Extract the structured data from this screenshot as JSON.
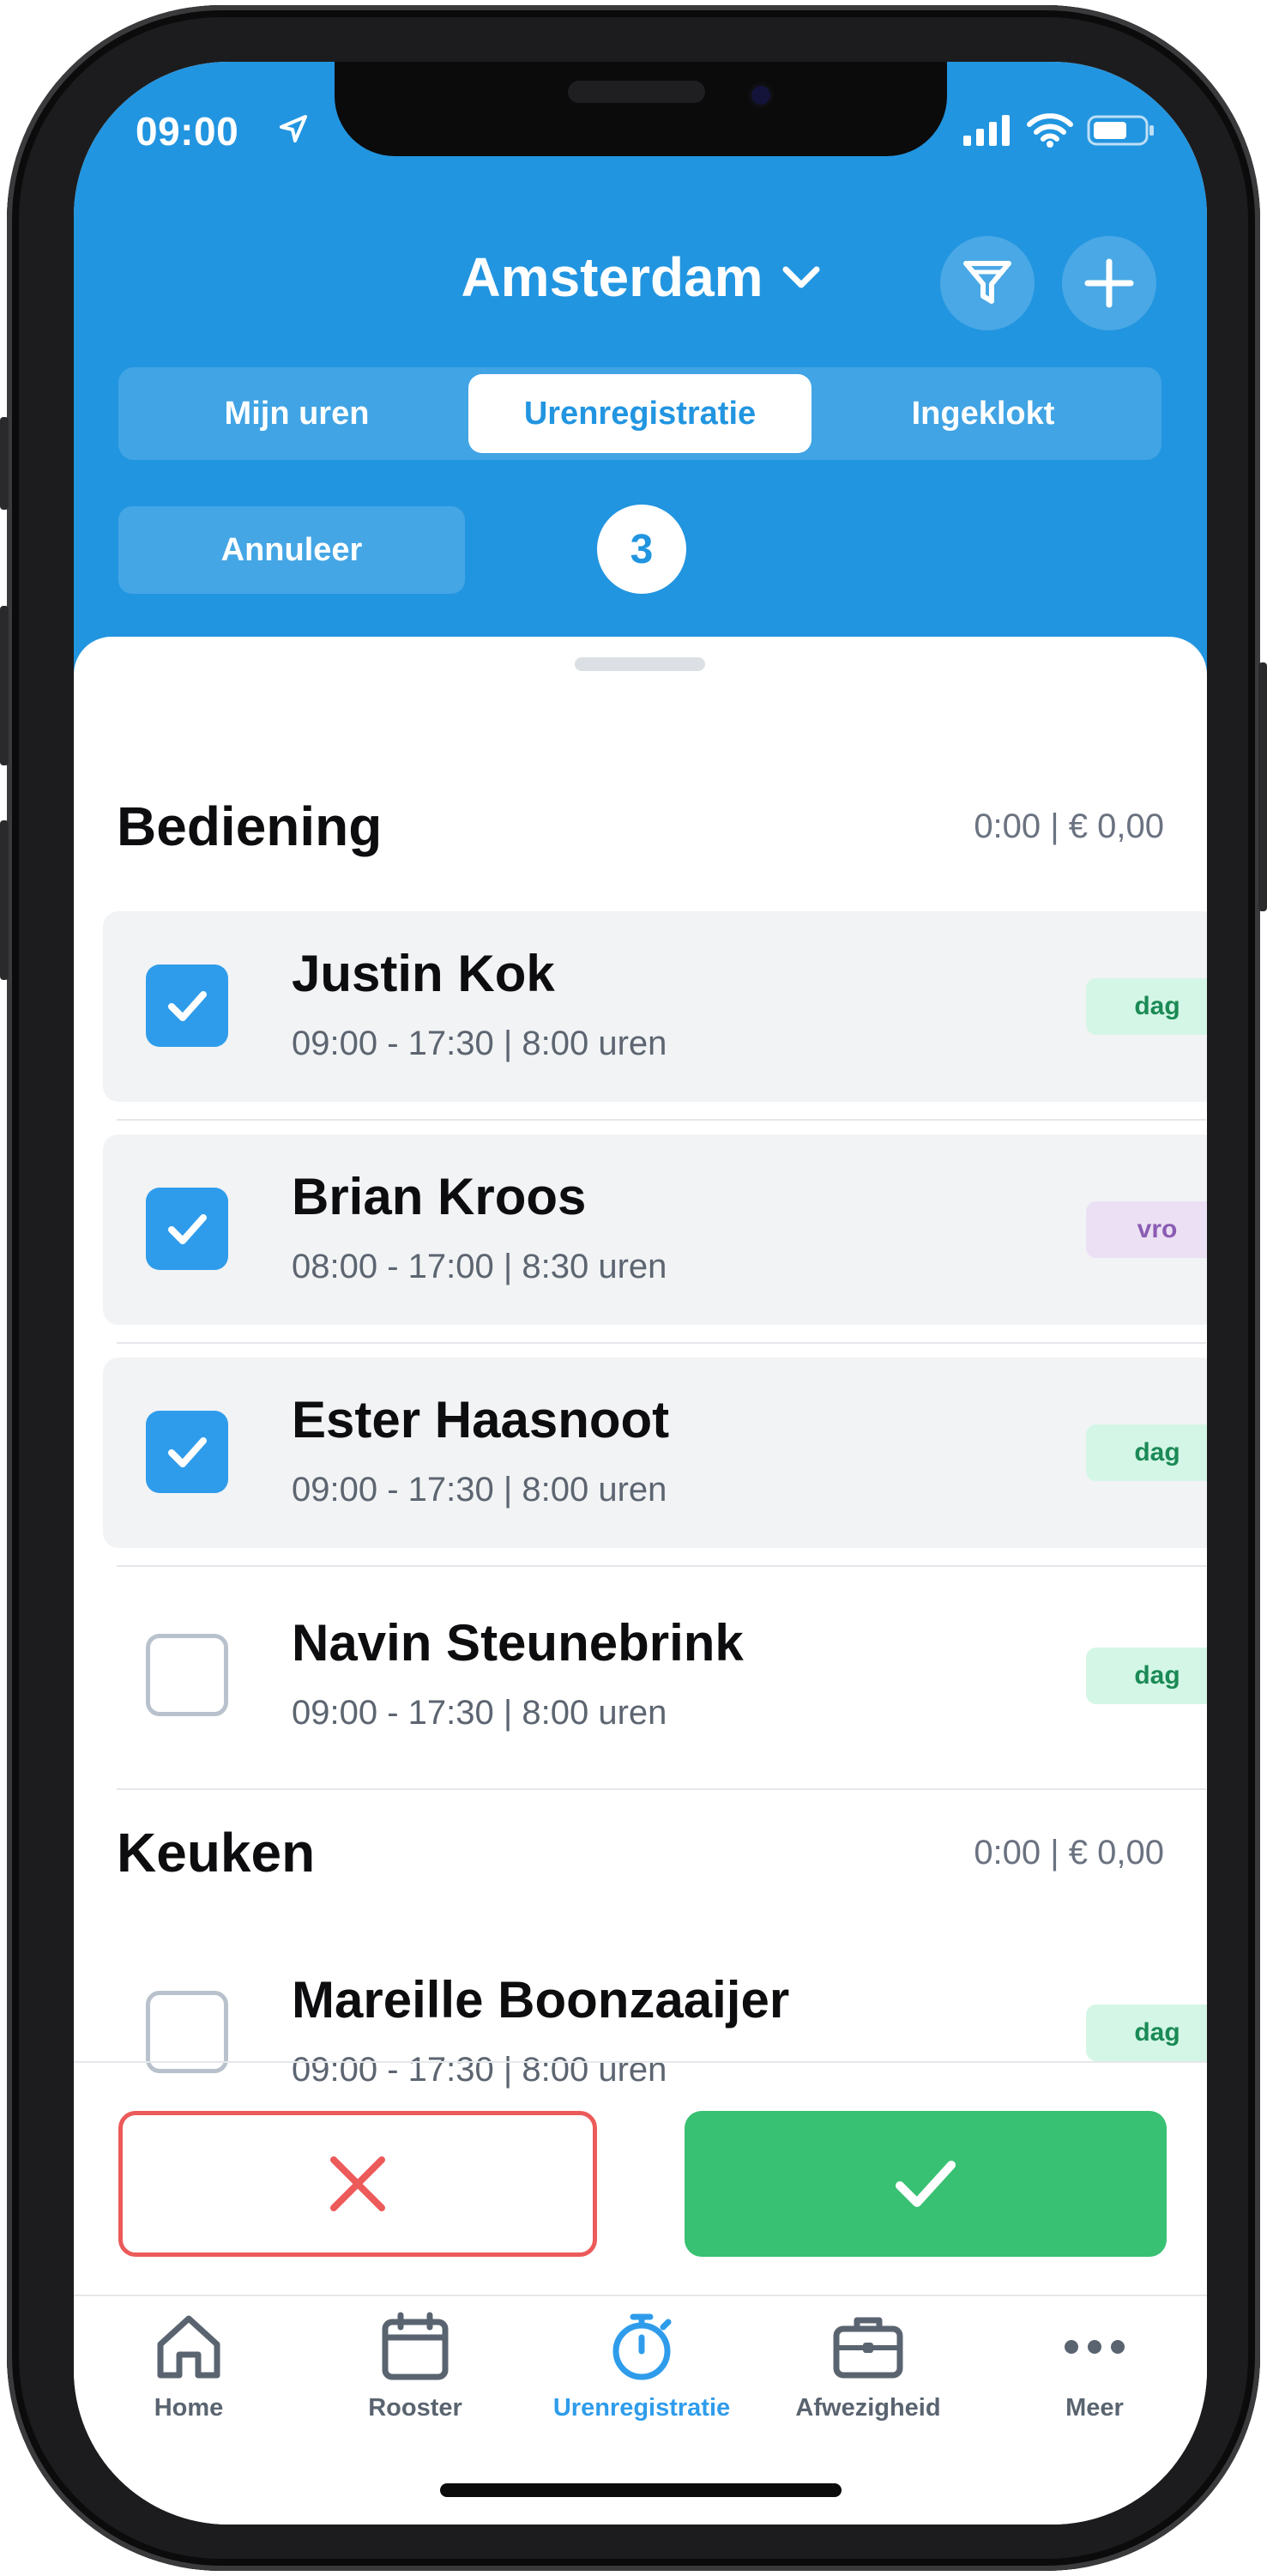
{
  "status_bar": {
    "time": "09:00"
  },
  "header": {
    "title": "Amsterdam",
    "tabs": [
      {
        "label": "Mijn uren",
        "active": false
      },
      {
        "label": "Urenregistratie",
        "active": true
      },
      {
        "label": "Ingeklokt",
        "active": false
      }
    ],
    "cancel_label": "Annuleer",
    "selected_count": "3"
  },
  "sections": [
    {
      "title": "Bediening",
      "total": "0:00 | € 0,00",
      "rows": [
        {
          "name": "Justin Kok",
          "time": "09:00 - 17:30 | 8:00 uren",
          "tag": "dag",
          "checked": true
        },
        {
          "name": "Brian Kroos",
          "time": "08:00 - 17:00 | 8:30 uren",
          "tag": "vro",
          "checked": true
        },
        {
          "name": "Ester Haasnoot",
          "time": "09:00 - 17:30 | 8:00 uren",
          "tag": "dag",
          "checked": true
        },
        {
          "name": "Navin Steunebrink",
          "time": "09:00 - 17:30 | 8:00 uren",
          "tag": "dag",
          "checked": false
        }
      ]
    },
    {
      "title": "Keuken",
      "total": "0:00 | € 0,00",
      "rows": [
        {
          "name": "Mareille Boonzaaijer",
          "time": "09:00 - 17:30 | 8:00 uren",
          "tag": "dag",
          "checked": false
        }
      ]
    }
  ],
  "nav": [
    {
      "label": "Home",
      "icon": "home-icon",
      "active": false
    },
    {
      "label": "Rooster",
      "icon": "calendar-icon",
      "active": false
    },
    {
      "label": "Urenregistratie",
      "icon": "stopwatch-icon",
      "active": true
    },
    {
      "label": "Afwezigheid",
      "icon": "briefcase-icon",
      "active": false
    },
    {
      "label": "Meer",
      "icon": "more-icon",
      "active": false
    }
  ],
  "colors": {
    "brand_blue": "#2295e0",
    "approve_green": "#38c172",
    "reject_red": "#ec5a5a",
    "tag_dag": "#1b8a56",
    "tag_vro": "#8a5cb3"
  }
}
